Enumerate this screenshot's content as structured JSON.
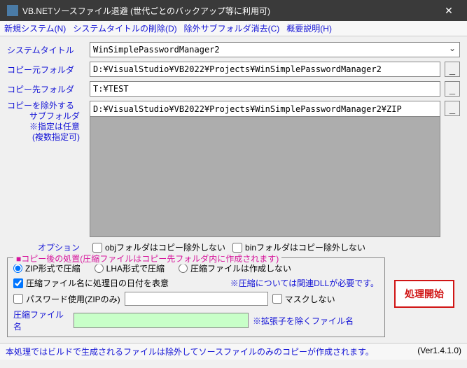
{
  "titlebar": {
    "title": "VB.NETソースファイル退避 (世代ごとのバックアップ等に利用可)"
  },
  "menu": {
    "new_system": "新規システム(N)",
    "delete_title": "システムタイトルの削除(D)",
    "clear_exclude": "除外サブフォルダ消去(C)",
    "help": "概要説明(H)"
  },
  "labels": {
    "system_title": "システムタイトル",
    "src_folder": "コピー元フォルダ",
    "dst_folder": "コピー先フォルダ",
    "exclude1": "コピーを除外する",
    "exclude2": "サブフォルダ",
    "exclude3": "※指定は任意",
    "exclude4": "(複数指定可)",
    "option": "オプション",
    "compress_name": "圧縮ファイル名"
  },
  "fields": {
    "system_title": "WinSimplePasswordManager2",
    "src_folder": "D:¥VisualStudio¥VB2022¥Projects¥WinSimplePasswordManager2",
    "dst_folder": "T:¥TEST",
    "exclude_input": "D:¥VisualStudio¥VB2022¥Projects¥WinSimplePasswordManager2¥ZIP",
    "compress_name": ""
  },
  "options": {
    "obj_no_exclude": "objフォルダはコピー除外しない",
    "bin_no_exclude": "binフォルダはコピー除外しない"
  },
  "group": {
    "title": "■コピー後の処置(圧縮ファイルはコピー先フォルダ内に作成されます)",
    "zip": "ZIP形式で圧縮",
    "lha": "LHA形式で圧縮",
    "none": "圧縮ファイルは作成しない",
    "date_in_name": "圧縮ファイル名に処理日の日付を表意",
    "dll_note": "※圧縮については関連DLLが必要です。",
    "use_password": "パスワード使用(ZIPのみ)",
    "no_mask": "マスクしない",
    "ext_note": "※拡張子を除くファイル名"
  },
  "buttons": {
    "start": "処理開始"
  },
  "footer": {
    "left": "本処理ではビルドで生成されるファイルは除外してソースファイルのみのコピーが作成されます。",
    "right": "(Ver1.4.1.0)"
  }
}
